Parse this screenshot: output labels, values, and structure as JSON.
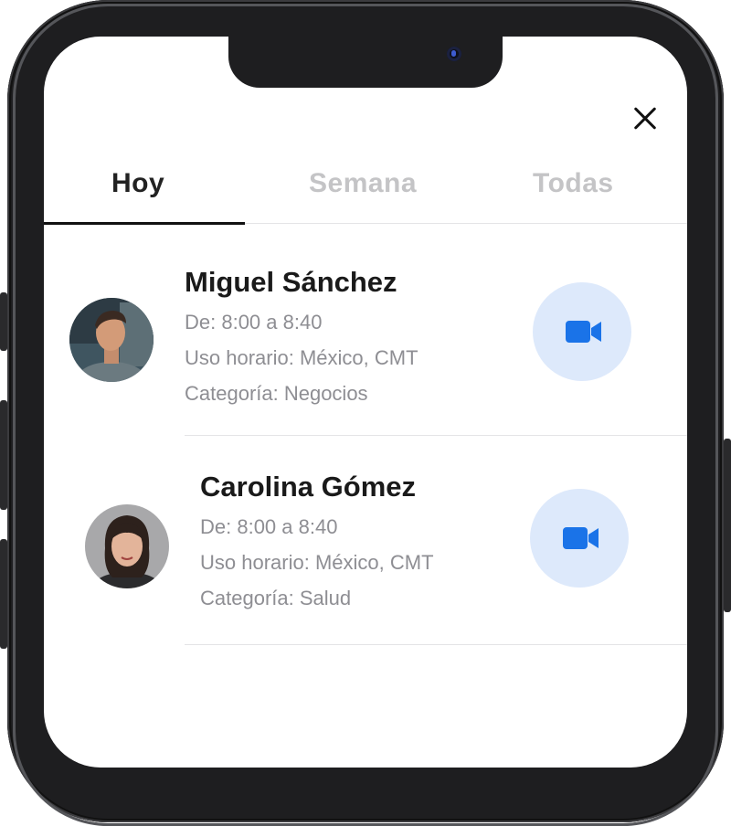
{
  "tabs": [
    {
      "label": "Hoy"
    },
    {
      "label": "Semana"
    },
    {
      "label": "Todas"
    }
  ],
  "appointments": [
    {
      "name": "Miguel Sánchez",
      "time": "De: 8:00 a 8:40",
      "timezone": "Uso horario: México, CMT",
      "category": "Categoría: Negocios"
    },
    {
      "name": "Carolina Gómez",
      "time": "De: 8:00 a 8:40",
      "timezone": "Uso horario: México, CMT",
      "category": "Categoría: Salud"
    }
  ],
  "colors": {
    "accent": "#1a73e8",
    "call_button_bg": "#dde9fb",
    "active_tab": "#222222",
    "inactive_tab": "#c4c4c6",
    "meta_text": "#8e8e93"
  },
  "icons": {
    "close": "close-icon",
    "call": "video-camera-icon"
  }
}
